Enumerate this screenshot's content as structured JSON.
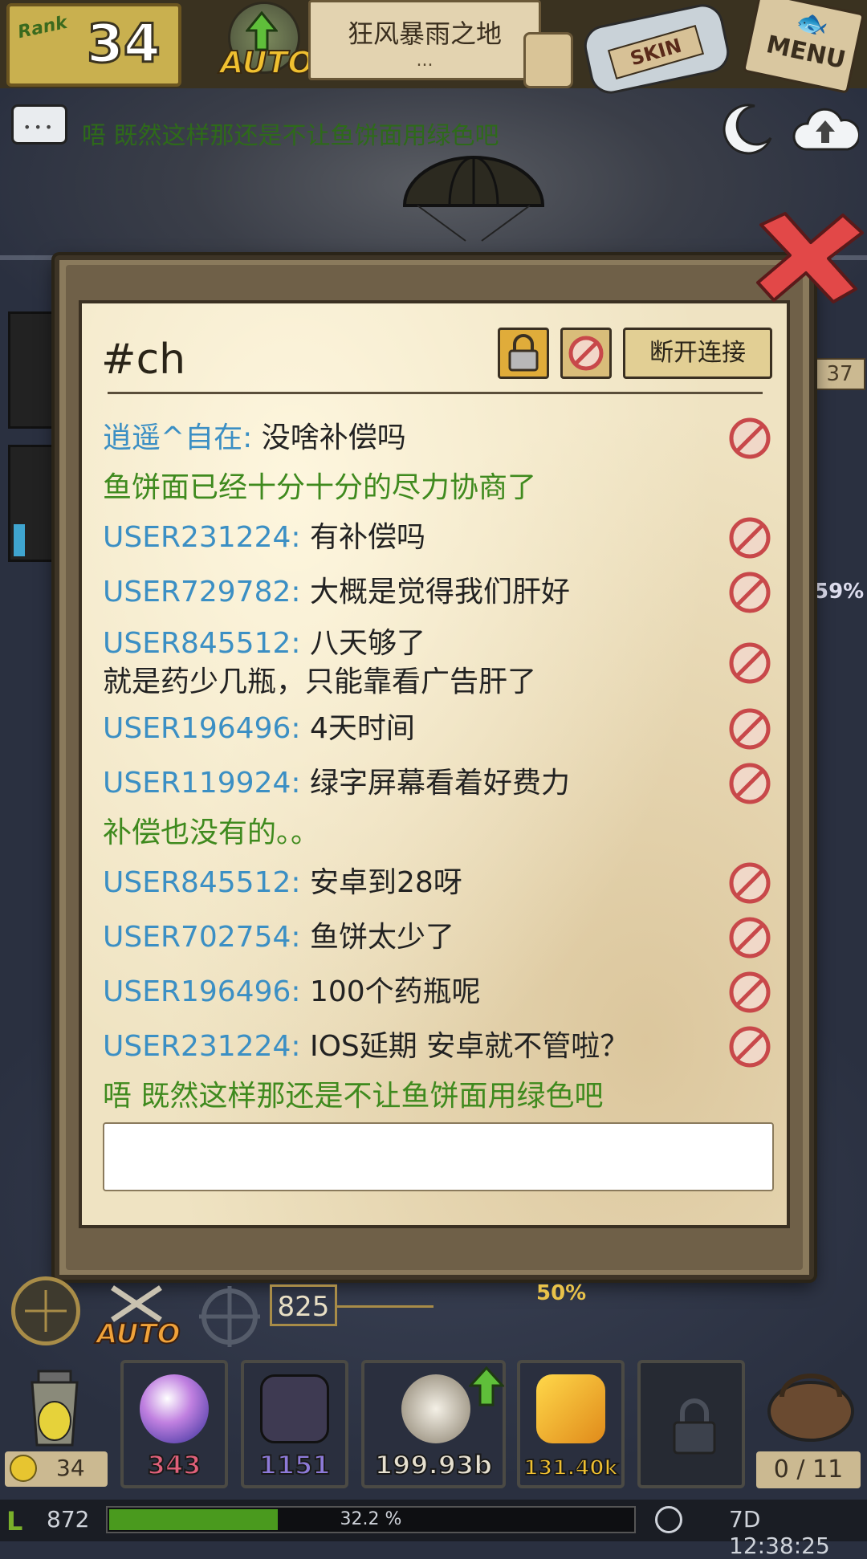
{
  "topbar": {
    "rank_label": "Rank",
    "rank_value": "34",
    "auto_label": "AUTO",
    "map_name": "狂风暴雨之地",
    "map_sub": "...",
    "skin_label": "SKIN",
    "menu_label": "MENU"
  },
  "ticker": {
    "text": "唔 既然这样那还是不让鱼饼面用绿色吧"
  },
  "chat": {
    "channel": "#ch",
    "disconnect_label": "断开连接",
    "messages": [
      {
        "user": "逍遥^自在: ",
        "text": "没啥补偿吗",
        "system": false
      },
      {
        "user": "",
        "text": "鱼饼面已经十分十分的尽力协商了",
        "system": true
      },
      {
        "user": "USER231224: ",
        "text": "有补偿吗",
        "system": false
      },
      {
        "user": "USER729782: ",
        "text": "大概是觉得我们肝好",
        "system": false
      },
      {
        "user": "USER845512: ",
        "text": "八天够了",
        "text2": "就是药少几瓶，只能靠看广告肝了",
        "system": false
      },
      {
        "user": "USER196496: ",
        "text": "4天时间",
        "system": false
      },
      {
        "user": "USER119924: ",
        "text": "绿字屏幕看着好费力",
        "system": false
      },
      {
        "user": "",
        "text": "补偿也没有的。。",
        "system": true
      },
      {
        "user": "USER845512: ",
        "text": "安卓到28呀",
        "system": false
      },
      {
        "user": "USER702754: ",
        "text": "鱼饼太少了",
        "system": false
      },
      {
        "user": "USER196496: ",
        "text": "100个药瓶呢",
        "system": false
      },
      {
        "user": "USER231224: ",
        "text": "IOS延期 安卓就不管啦？",
        "system": false
      },
      {
        "user": "",
        "text": "唔 既然这样那还是不让鱼饼面用绿色吧",
        "system": true
      }
    ],
    "input_value": ""
  },
  "side": {
    "right_badge": "37",
    "right_pct": "59%"
  },
  "hud": {
    "auto_label": "AUTO",
    "distance": "825",
    "pct": "50%",
    "potion_count": "34",
    "slots": [
      {
        "name": "orb",
        "value": "343",
        "color": "#e0607a"
      },
      {
        "name": "shield",
        "value": "1151",
        "color": "#8d7ad8"
      },
      {
        "name": "gear",
        "value": "199.93b",
        "color": "#e6e0d0"
      },
      {
        "name": "gold",
        "value": "131.40k",
        "color": "#f0c030"
      }
    ],
    "bag_count": "0 / 11"
  },
  "status": {
    "level": "872",
    "xp_percent_text": "32.2 %",
    "xp_fraction": 0.322,
    "timer": "7D 12:38:25"
  }
}
